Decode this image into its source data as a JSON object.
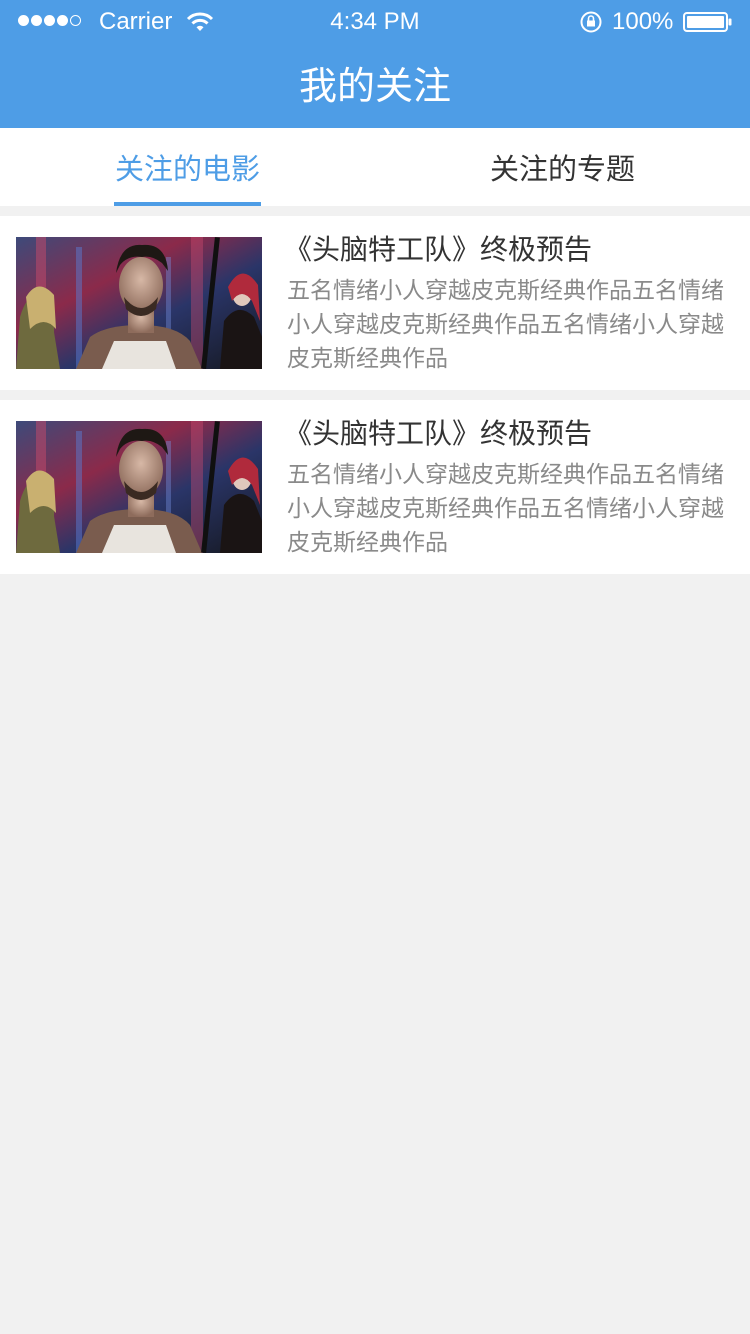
{
  "status_bar": {
    "carrier": "Carrier",
    "time": "4:34 PM",
    "battery": "100%",
    "icons": [
      "signal-dots-icon",
      "wifi-icon",
      "rotation-lock-icon",
      "battery-icon"
    ]
  },
  "nav": {
    "title": "我的关注"
  },
  "tabs": [
    {
      "label": "关注的电影",
      "active": true
    },
    {
      "label": "关注的专题",
      "active": false
    }
  ],
  "items": [
    {
      "title": "《头脑特工队》终极预告",
      "description": "五名情绪小人穿越皮克斯经典作品五名情绪小人穿越皮克斯经典作品五名情绪小人穿越皮克斯经典作品"
    },
    {
      "title": "《头脑特工队》终极预告",
      "description": "五名情绪小人穿越皮克斯经典作品五名情绪小人穿越皮克斯经典作品五名情绪小人穿越皮克斯经典作品"
    }
  ],
  "colors": {
    "accent": "#4e9de6",
    "background": "#f1f1f1",
    "title_text": "#333333",
    "description_text": "#8a8a8a"
  }
}
